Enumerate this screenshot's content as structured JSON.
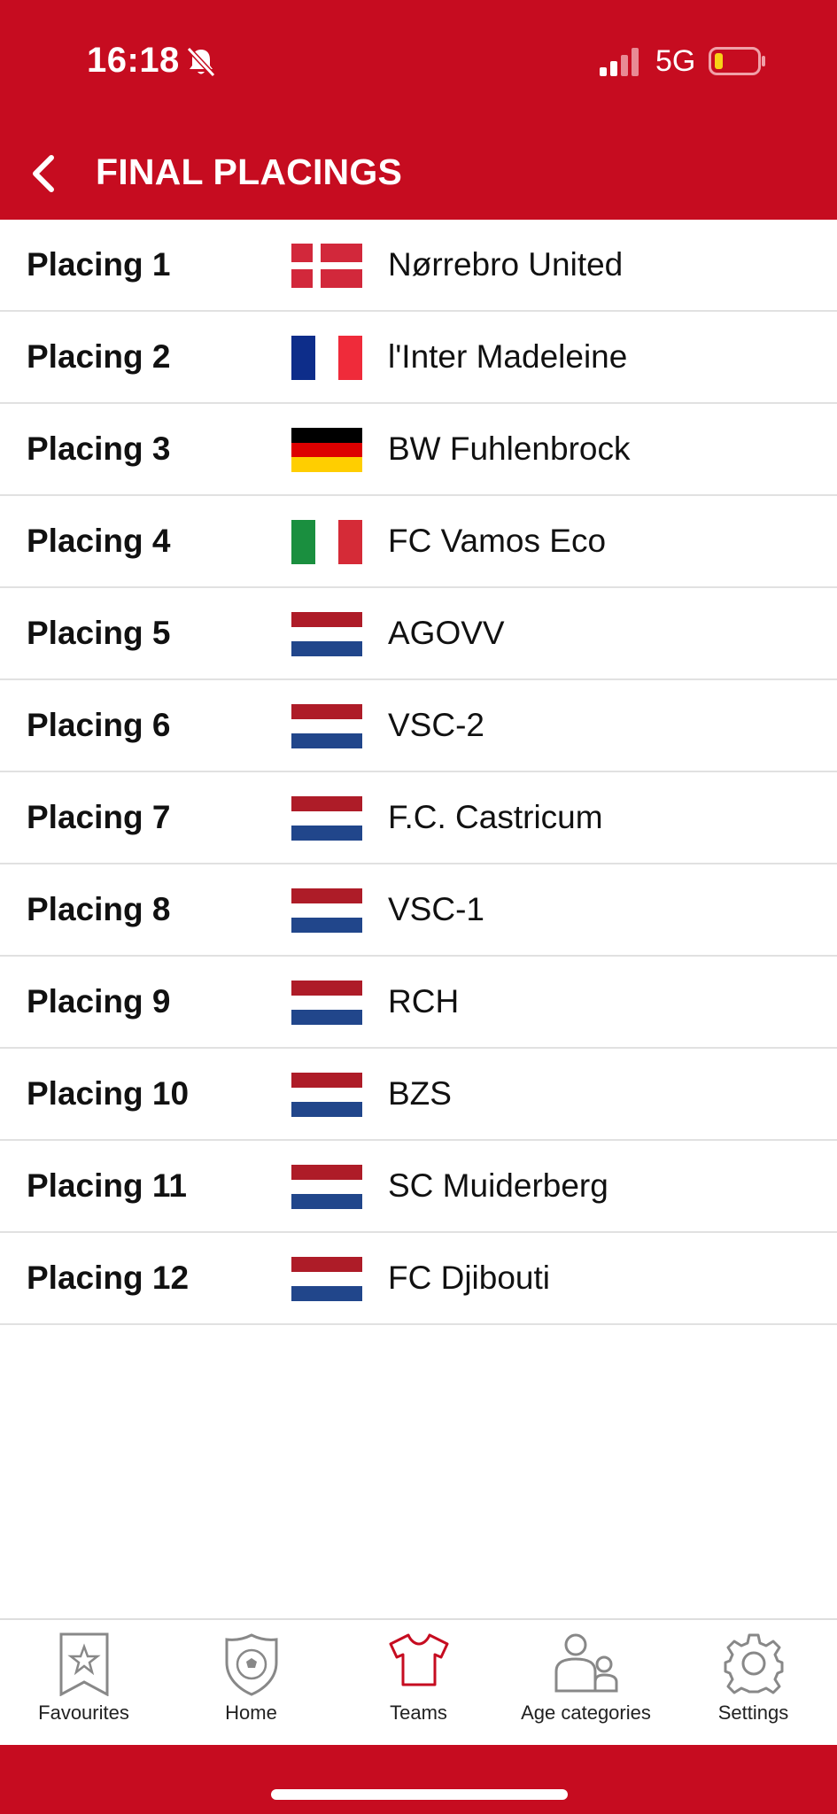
{
  "status_bar": {
    "time": "16:18",
    "network": "5G",
    "icons": [
      "bell-muted-icon",
      "signal-icon",
      "battery-low-icon"
    ]
  },
  "header": {
    "title": "FINAL PLACINGS",
    "back_icon": "chevron-left-icon"
  },
  "colors": {
    "brand_red": "#c60c20",
    "divider": "#e1e1e1"
  },
  "placings": [
    {
      "label": "Placing 1",
      "team": "Nørrebro United",
      "flag": "denmark"
    },
    {
      "label": "Placing 2",
      "team": "l'Inter Madeleine",
      "flag": "france"
    },
    {
      "label": "Placing 3",
      "team": "BW Fuhlenbrock",
      "flag": "germany"
    },
    {
      "label": "Placing 4",
      "team": "FC Vamos Eco",
      "flag": "italy"
    },
    {
      "label": "Placing 5",
      "team": "AGOVV",
      "flag": "netherlands"
    },
    {
      "label": "Placing 6",
      "team": "VSC-2",
      "flag": "netherlands"
    },
    {
      "label": "Placing 7",
      "team": "F.C. Castricum",
      "flag": "netherlands"
    },
    {
      "label": "Placing 8",
      "team": "VSC-1",
      "flag": "netherlands"
    },
    {
      "label": "Placing 9",
      "team": "RCH",
      "flag": "netherlands"
    },
    {
      "label": "Placing 10",
      "team": "BZS",
      "flag": "netherlands"
    },
    {
      "label": "Placing 11",
      "team": "SC Muiderberg",
      "flag": "netherlands"
    },
    {
      "label": "Placing 12",
      "team": "FC Djibouti",
      "flag": "netherlands"
    }
  ],
  "tabbar": {
    "items": [
      {
        "label": "Favourites",
        "icon": "star-bookmark-icon"
      },
      {
        "label": "Home",
        "icon": "shield-ball-icon"
      },
      {
        "label": "Teams",
        "icon": "shirt-icon",
        "active": true
      },
      {
        "label": "Age categories",
        "icon": "people-icon"
      },
      {
        "label": "Settings",
        "icon": "gear-icon"
      }
    ]
  }
}
